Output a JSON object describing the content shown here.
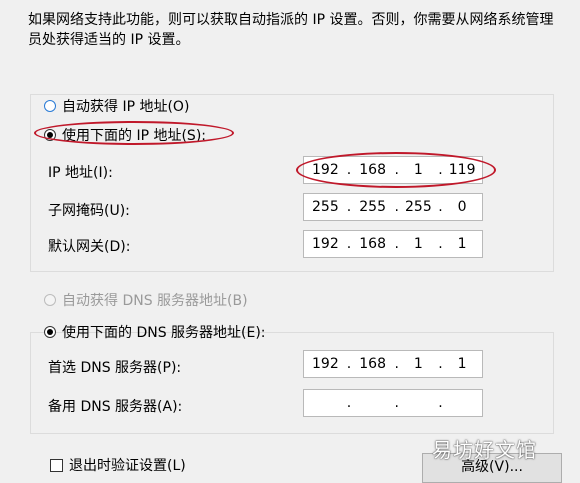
{
  "description": "如果网络支持此功能，则可以获取自动指派的 IP 设置。否则，你需要从网络系统管理员处获得适当的 IP 设置。",
  "ip": {
    "auto_label": "自动获得 IP 地址(O)",
    "manual_label": "使用下面的 IP 地址(S):",
    "selected": "manual",
    "fields": [
      {
        "label": "IP 地址(I):",
        "octets": [
          "192",
          "168",
          "1",
          "119"
        ]
      },
      {
        "label": "子网掩码(U):",
        "octets": [
          "255",
          "255",
          "255",
          "0"
        ]
      },
      {
        "label": "默认网关(D):",
        "octets": [
          "192",
          "168",
          "1",
          "1"
        ]
      }
    ]
  },
  "dns": {
    "auto_label": "自动获得 DNS 服务器地址(B)",
    "manual_label": "使用下面的 DNS 服务器地址(E):",
    "selected": "manual",
    "fields": [
      {
        "label": "首选 DNS 服务器(P):",
        "octets": [
          "192",
          "168",
          "1",
          "1"
        ]
      },
      {
        "label": "备用 DNS 服务器(A):",
        "octets": [
          "",
          "",
          "",
          ""
        ]
      }
    ]
  },
  "validate_label": "退出时验证设置(L)",
  "advanced_button": "高级(V)...",
  "watermark": "易坊好文馆",
  "colors": {
    "annotation": "#c0182a",
    "radio_focus": "#2a7bd6"
  }
}
